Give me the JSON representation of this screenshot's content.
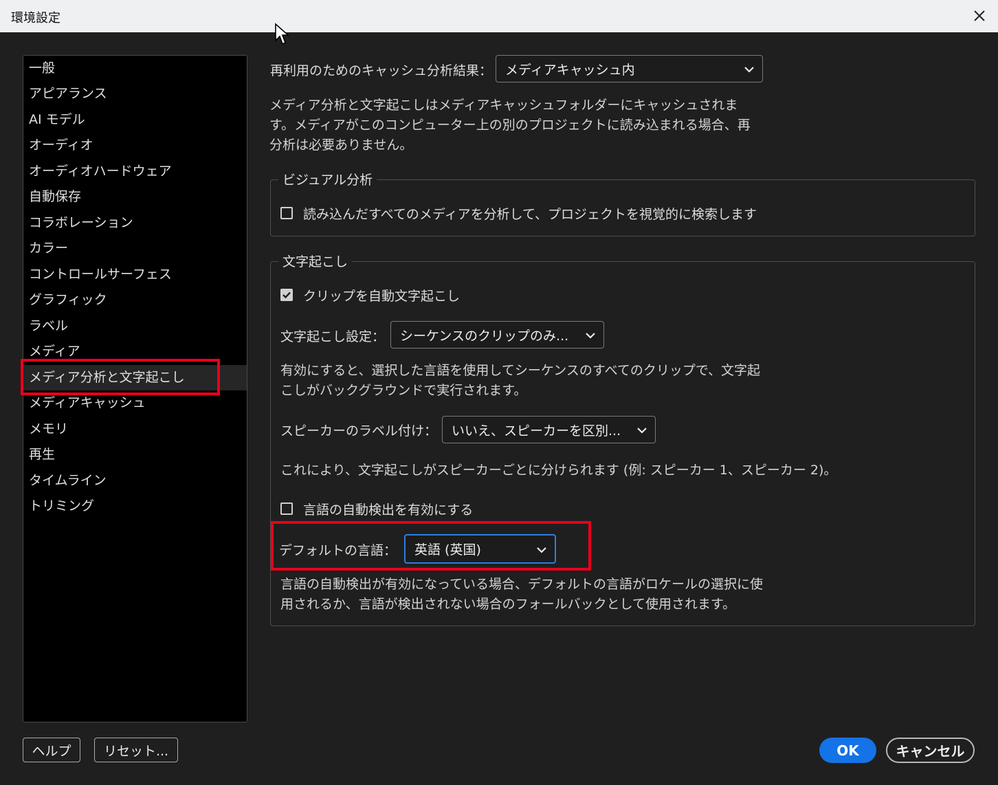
{
  "window": {
    "title": "環境設定",
    "close_icon": "close-icon"
  },
  "sidebar": {
    "items": [
      {
        "label": "一般"
      },
      {
        "label": "アピアランス"
      },
      {
        "label": "AI モデル"
      },
      {
        "label": "オーディオ"
      },
      {
        "label": "オーディオハードウェア"
      },
      {
        "label": "自動保存"
      },
      {
        "label": "コラボレーション"
      },
      {
        "label": "カラー"
      },
      {
        "label": "コントロールサーフェス"
      },
      {
        "label": "グラフィック"
      },
      {
        "label": "ラベル"
      },
      {
        "label": "メディア"
      },
      {
        "label": "メディア分析と文字起こし"
      },
      {
        "label": "メディアキャッシュ"
      },
      {
        "label": "メモリ"
      },
      {
        "label": "再生"
      },
      {
        "label": "タイムライン"
      },
      {
        "label": "トリミング"
      }
    ],
    "selected": "メディア分析と文字起こし"
  },
  "footer": {
    "help_label": "ヘルプ",
    "reset_label": "リセット...",
    "ok_label": "OK",
    "cancel_label": "キャンセル"
  },
  "cache": {
    "label": "再利用のためのキャッシュ分析結果：",
    "value": "メディアキャッシュ内",
    "description_lines": [
      "メディア分析と文字起こしはメディアキャッシュフォルダーにキャッシュされま",
      "す。メディアがこのコンピューター上の別のプロジェクトに読み込まれる場合、再",
      "分析は必要ありません。"
    ]
  },
  "visual": {
    "group_title": "ビジュアル分析",
    "checkbox_label": "読み込んだすべてのメディアを分析して、プロジェクトを視覚的に検索します",
    "checked": false
  },
  "transcription": {
    "group_title": "文字起こし",
    "auto_label": "クリップを自動文字起こし",
    "auto_checked": true,
    "settings_label": "文字起こし設定：",
    "settings_value": "シーケンスのクリップのみ...",
    "settings_desc_lines": [
      "有効にすると、選択した言語を使用してシーケンスのすべてのクリップで、文字起",
      "こしがバックグラウンドで実行されます。"
    ],
    "speaker_label": "スピーカーのラベル付け：",
    "speaker_value": "いいえ、スピーカーを区別...",
    "speaker_desc": "これにより、文字起こしがスピーカーごとに分けられます (例: スピーカー 1、スピーカー 2)。",
    "autodetect_label": "言語の自動検出を有効にする",
    "autodetect_checked": false,
    "default_lang_label": "デフォルトの言語：",
    "default_lang_value": "英語 (英国)",
    "default_lang_desc_lines": [
      "言語の自動検出が有効になっている場合、デフォルトの言語がロケールの選択に使",
      "用されるか、言語が検出されない場合のフォールバックとして使用されます。"
    ]
  },
  "colors": {
    "accent": "#1473e6",
    "highlight": "#e8001c",
    "background": "#1f1f1f"
  }
}
